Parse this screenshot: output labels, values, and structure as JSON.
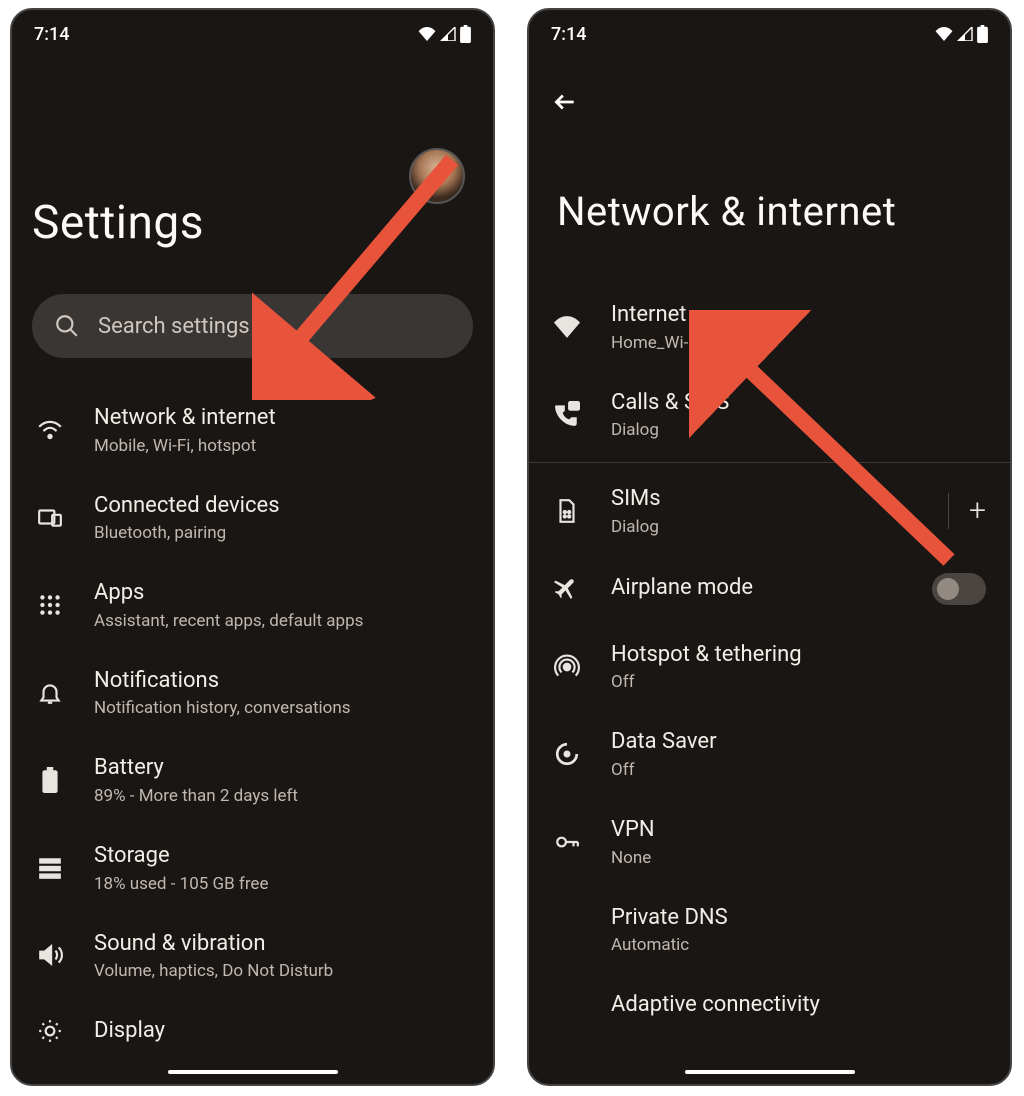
{
  "status": {
    "time": "7:14"
  },
  "left": {
    "title": "Settings",
    "search_placeholder": "Search settings",
    "items": [
      {
        "title": "Network & internet",
        "subtitle": "Mobile, Wi-Fi, hotspot"
      },
      {
        "title": "Connected devices",
        "subtitle": "Bluetooth, pairing"
      },
      {
        "title": "Apps",
        "subtitle": "Assistant, recent apps, default apps"
      },
      {
        "title": "Notifications",
        "subtitle": "Notification history, conversations"
      },
      {
        "title": "Battery",
        "subtitle": "89% - More than 2 days left"
      },
      {
        "title": "Storage",
        "subtitle": "18% used - 105 GB free"
      },
      {
        "title": "Sound & vibration",
        "subtitle": "Volume, haptics, Do Not Disturb"
      },
      {
        "title": "Display",
        "subtitle": ""
      }
    ]
  },
  "right": {
    "title": "Network & internet",
    "items": [
      {
        "title": "Internet",
        "subtitle": "Home_Wi-Fi"
      },
      {
        "title": "Calls & SMS",
        "subtitle": "Dialog"
      },
      {
        "title": "SIMs",
        "subtitle": "Dialog"
      },
      {
        "title": "Airplane mode",
        "subtitle": ""
      },
      {
        "title": "Hotspot & tethering",
        "subtitle": "Off"
      },
      {
        "title": "Data Saver",
        "subtitle": "Off"
      },
      {
        "title": "VPN",
        "subtitle": "None"
      },
      {
        "title": "Private DNS",
        "subtitle": "Automatic"
      },
      {
        "title": "Adaptive connectivity",
        "subtitle": ""
      }
    ]
  }
}
